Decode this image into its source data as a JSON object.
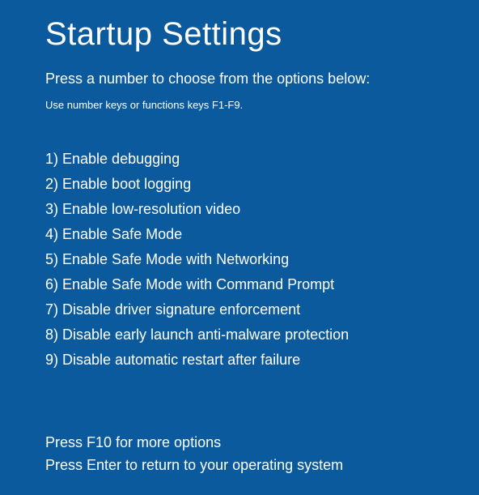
{
  "title": "Startup Settings",
  "instruction": "Press a number to choose from the options below:",
  "hint": "Use number keys or functions keys F1-F9.",
  "options": [
    "1) Enable debugging",
    "2) Enable boot logging",
    "3) Enable low-resolution video",
    "4) Enable Safe Mode",
    "5) Enable Safe Mode with Networking",
    "6) Enable Safe Mode with Command Prompt",
    "7) Disable driver signature enforcement",
    "8) Disable early launch anti-malware protection",
    "9) Disable automatic restart after failure"
  ],
  "footer": {
    "more": "Press F10 for more options",
    "return": "Press Enter to return to your operating system"
  }
}
